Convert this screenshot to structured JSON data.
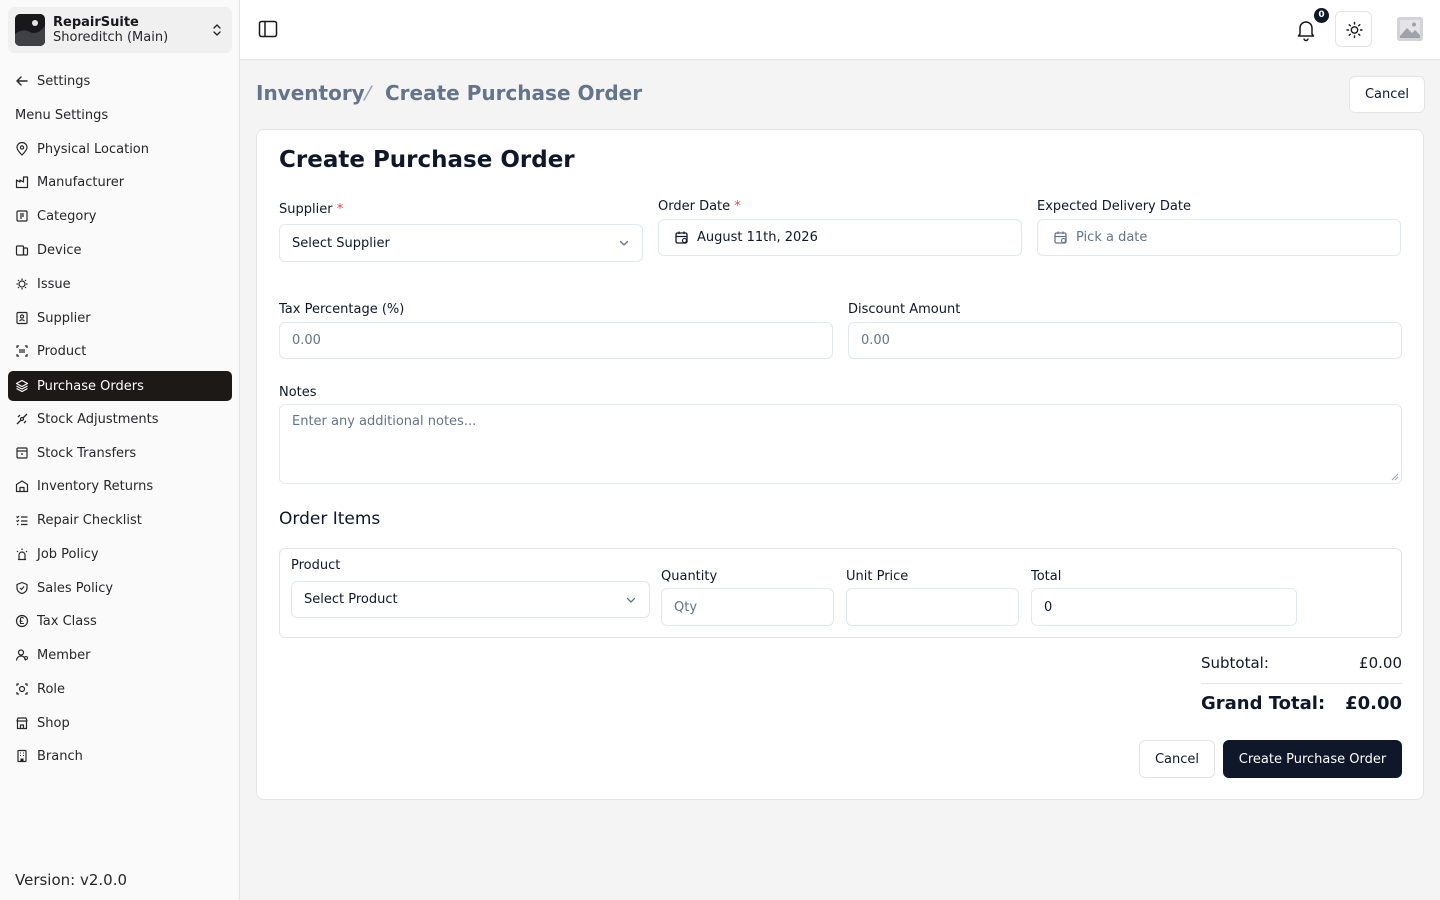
{
  "workspace": {
    "name": "RepairSuite",
    "branch": "Shoreditch (Main)"
  },
  "sidebar": {
    "back_label": "Settings",
    "section_label": "Menu Settings",
    "items": [
      {
        "label": "Physical Location",
        "icon": "map-pin-icon"
      },
      {
        "label": "Manufacturer",
        "icon": "factory-icon"
      },
      {
        "label": "Category",
        "icon": "category-icon"
      },
      {
        "label": "Device",
        "icon": "devices-icon"
      },
      {
        "label": "Issue",
        "icon": "bug-icon"
      },
      {
        "label": "Supplier",
        "icon": "contact-icon"
      },
      {
        "label": "Product",
        "icon": "barcode-icon"
      },
      {
        "label": "Purchase Orders",
        "icon": "layers-icon",
        "active": true
      },
      {
        "label": "Stock Adjustments",
        "icon": "adjust-icon"
      },
      {
        "label": "Stock Transfers",
        "icon": "transfer-icon"
      },
      {
        "label": "Inventory Returns",
        "icon": "return-icon"
      },
      {
        "label": "Repair Checklist",
        "icon": "checklist-icon"
      },
      {
        "label": "Job Policy",
        "icon": "policy-icon"
      },
      {
        "label": "Sales Policy",
        "icon": "shield-icon"
      },
      {
        "label": "Tax Class",
        "icon": "currency-pound-icon"
      },
      {
        "label": "Member",
        "icon": "user-icon"
      },
      {
        "label": "Role",
        "icon": "role-icon"
      },
      {
        "label": "Shop",
        "icon": "store-icon"
      },
      {
        "label": "Branch",
        "icon": "building-icon"
      }
    ],
    "version": "Version: v2.0.0"
  },
  "topbar": {
    "notification_count": "0"
  },
  "breadcrumb": {
    "parent": "Inventory",
    "current": "Create Purchase Order"
  },
  "header_cancel": "Cancel",
  "form": {
    "title": "Create Purchase Order",
    "supplier": {
      "label": "Supplier",
      "required": "*",
      "placeholder": "Select Supplier"
    },
    "order_date": {
      "label": "Order Date",
      "required": "*",
      "value": "August 11th, 2026"
    },
    "expected_delivery": {
      "label": "Expected Delivery Date",
      "placeholder": "Pick a date"
    },
    "tax": {
      "label": "Tax Percentage (%)",
      "placeholder": "0.00"
    },
    "discount": {
      "label": "Discount Amount",
      "placeholder": "0.00"
    },
    "notes": {
      "label": "Notes",
      "placeholder": "Enter any additional notes..."
    }
  },
  "order_items": {
    "title": "Order Items",
    "product": {
      "label": "Product",
      "placeholder": "Select Product"
    },
    "quantity": {
      "label": "Quantity",
      "placeholder": "Qty"
    },
    "unit_price": {
      "label": "Unit Price",
      "value": ""
    },
    "total": {
      "label": "Total",
      "value": "0"
    }
  },
  "summary": {
    "subtotal_label": "Subtotal:",
    "subtotal_value": "£0.00",
    "grand_total_label": "Grand Total:",
    "grand_total_value": "£0.00"
  },
  "actions": {
    "cancel": "Cancel",
    "submit": "Create Purchase Order"
  },
  "colors": {
    "active_nav": "#1c1917",
    "primary_button": "#0f172a",
    "required": "#ef4444",
    "muted_text": "#64748b"
  }
}
